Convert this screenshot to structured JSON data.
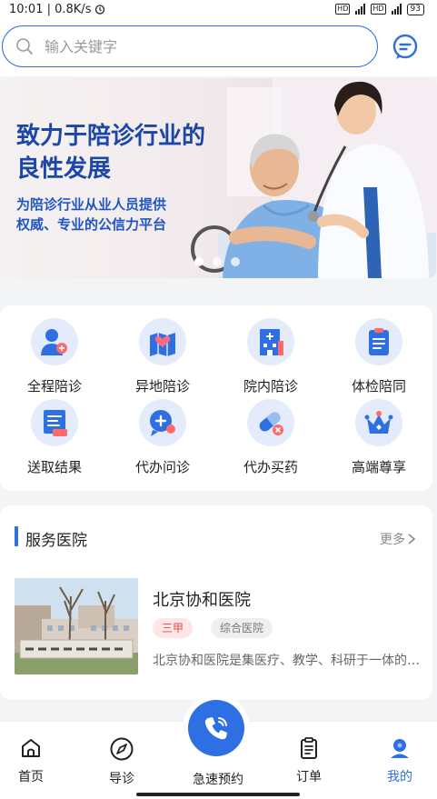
{
  "status_bar": {
    "time": "10:01 | 0.8K/s",
    "battery": "93"
  },
  "search": {
    "placeholder": "输入关键字"
  },
  "banner": {
    "title_line1": "致力于陪诊行业的",
    "title_line2": "良性发展",
    "subtitle_line1": "为陪诊行业从业人员提供",
    "subtitle_line2": "权威、专业的公信力平台"
  },
  "services": [
    {
      "label": "全程陪诊",
      "icon": "nurse-icon"
    },
    {
      "label": "异地陪诊",
      "icon": "map-heart-icon"
    },
    {
      "label": "院内陪诊",
      "icon": "hospital-building-icon"
    },
    {
      "label": "体检陪同",
      "icon": "clipboard-icon"
    },
    {
      "label": "送取结果",
      "icon": "report-icon"
    },
    {
      "label": "代办问诊",
      "icon": "chat-plus-icon"
    },
    {
      "label": "代办买药",
      "icon": "pill-icon"
    },
    {
      "label": "高端尊享",
      "icon": "crown-icon"
    }
  ],
  "hospital_section": {
    "title": "服务医院",
    "more": "更多"
  },
  "hospital": {
    "name": "北京协和医院",
    "level": "三甲",
    "type": "综合医院",
    "description": "北京协和医院是集医疗、教学、科研于一体的大型三级甲等综合医院"
  },
  "bottom_nav": {
    "home": "首页",
    "guide": "导诊",
    "quick_booking": "急速预约",
    "orders": "订单",
    "mine": "我的"
  },
  "colors": {
    "primary": "#2f6fe4",
    "banner_title": "#1a47a8",
    "tag_red": "#e24b4b"
  }
}
